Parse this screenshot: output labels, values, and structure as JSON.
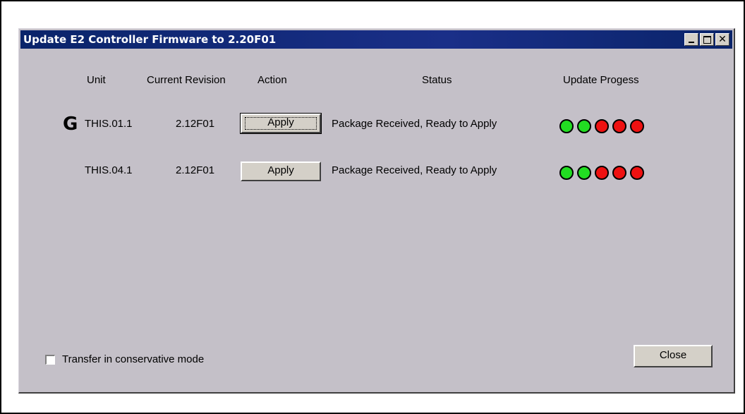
{
  "window": {
    "title": "Update E2 Controller Firmware to 2.20F01",
    "close_glyph": "✕"
  },
  "columns": {
    "unit": "Unit",
    "revision": "Current Revision",
    "action": "Action",
    "status": "Status",
    "progress": "Update Progess"
  },
  "rows": [
    {
      "marker": "G",
      "unit": "THIS.01.1",
      "revision": "2.12F01",
      "action_label": "Apply",
      "status": "Package Received, Ready to Apply",
      "progress": [
        "green",
        "green",
        "red",
        "red",
        "red"
      ]
    },
    {
      "marker": "",
      "unit": "THIS.04.1",
      "revision": "2.12F01",
      "action_label": "Apply",
      "status": "Package Received, Ready to Apply",
      "progress": [
        "green",
        "green",
        "red",
        "red",
        "red"
      ]
    }
  ],
  "footer": {
    "conservative_label": "Transfer in conservative mode",
    "conservative_checked": false,
    "close_label": "Close"
  },
  "colors": {
    "green": "#22dd22",
    "red": "#ee1111",
    "window_bg": "#c4c0c8",
    "titlebar": "#0a246a"
  }
}
